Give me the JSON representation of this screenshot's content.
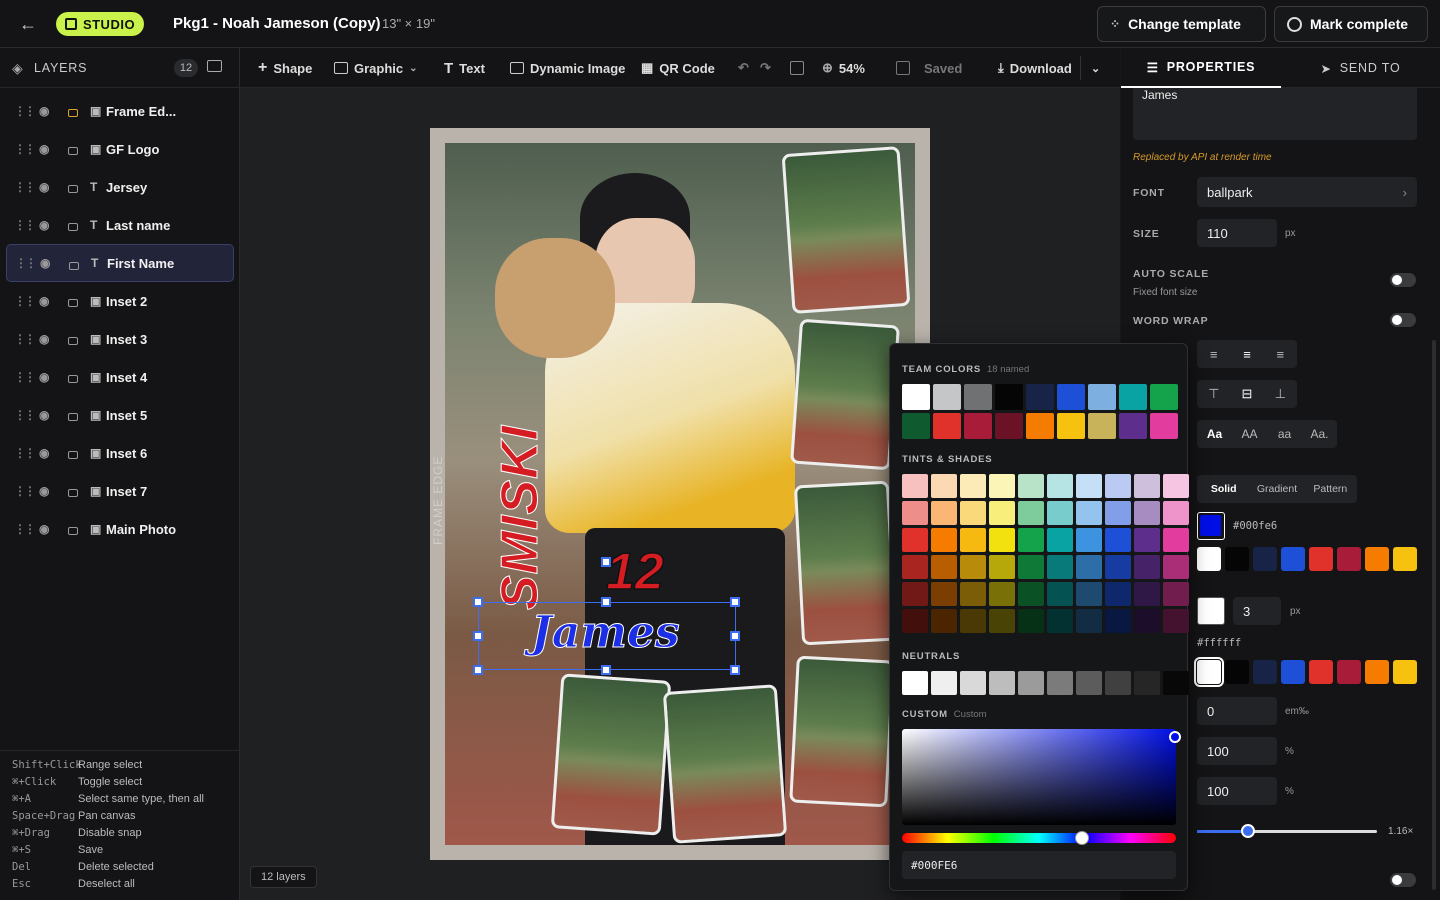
{
  "top": {
    "badge": "STUDIO",
    "title": "Pkg1 - Noah Jameson (Copy)",
    "size": "13\" × 19\"",
    "change_template": "Change template",
    "mark_complete": "Mark complete"
  },
  "sidebar": {
    "title": "LAYERS",
    "count": "12",
    "layers": [
      {
        "name": "Frame Ed...",
        "type": "img",
        "locked_accent": true
      },
      {
        "name": "GF Logo",
        "type": "img"
      },
      {
        "name": "Jersey",
        "type": "text"
      },
      {
        "name": "Last name",
        "type": "text"
      },
      {
        "name": "First Name",
        "type": "text",
        "selected": true
      },
      {
        "name": "Inset 2",
        "type": "img"
      },
      {
        "name": "Inset 3",
        "type": "img"
      },
      {
        "name": "Inset 4",
        "type": "img"
      },
      {
        "name": "Inset 5",
        "type": "img"
      },
      {
        "name": "Inset 6",
        "type": "img"
      },
      {
        "name": "Inset 7",
        "type": "img"
      },
      {
        "name": "Main Photo",
        "type": "img"
      }
    ],
    "shortcuts": [
      [
        "Shift+Click",
        "Range select"
      ],
      [
        "⌘+Click",
        "Toggle select"
      ],
      [
        "⌘+A",
        "Select same type, then all"
      ],
      [
        "Space+Drag",
        "Pan canvas"
      ],
      [
        "⌘+Drag",
        "Disable snap"
      ],
      [
        "⌘+S",
        "Save"
      ],
      [
        "Del",
        "Delete selected"
      ],
      [
        "Esc",
        "Deselect all"
      ]
    ]
  },
  "toolbar": {
    "shape": "Shape",
    "graphic": "Graphic",
    "text": "Text",
    "dynamic_image": "Dynamic Image",
    "qr_code": "QR Code",
    "zoom": "54%",
    "saved": "Saved",
    "download": "Download"
  },
  "canvas": {
    "layer_count": "12 layers",
    "frame_text": "FRAME EDGE",
    "last_name": "SMISKI",
    "jersey": "12",
    "first_name": "James"
  },
  "panel": {
    "tab_properties": "PROPERTIES",
    "tab_send": "SEND TO",
    "text_value": "James",
    "api_note": "Replaced by API at render time",
    "font_label": "FONT",
    "font_value": "ballpark",
    "size_label": "SIZE",
    "size_value": "110",
    "size_unit": "px",
    "auto_scale": "AUTO SCALE",
    "auto_scale_sub": "Fixed font size",
    "word_wrap": "WORD WRAP",
    "case_opts": [
      "Aa",
      "AA",
      "aa",
      "Aa."
    ],
    "fill_tabs": [
      "Solid",
      "Gradient",
      "Pattern"
    ],
    "fill_hex": "#000fe6",
    "stroke_width": "3",
    "stroke_unit": "px",
    "stroke_hex": "#ffffff",
    "tracking": "0",
    "tracking_unit": "em‰",
    "scale_x": "100",
    "scale_y": "100",
    "pct": "%",
    "scale_val": "1.16×",
    "fill_color": "#000fe6",
    "stroke_color": "#ffffff"
  },
  "picker": {
    "team_title": "TEAM COLORS",
    "team_sub": "18 named",
    "tints_title": "TINTS & SHADES",
    "neutrals_title": "NEUTRALS",
    "custom_title": "CUSTOM",
    "custom_sub": "Custom",
    "hex_value": "#000FE6",
    "team_colors": [
      "#ffffff",
      "#c4c6c8",
      "#6f7173",
      "#050505",
      "#172447",
      "#1d4fd7",
      "#7db0e0",
      "#0aa3a3",
      "#14a24a",
      "#0f5a2e",
      "#e0312b",
      "#a81c3a",
      "#6b1226",
      "#f57c00",
      "#f6c10f",
      "#c9b35a",
      "#5d2e8c",
      "#e13c9e"
    ],
    "neutrals": [
      "#ffffff",
      "#efefef",
      "#d9d9d9",
      "#bdbdbd",
      "#9b9b9b",
      "#7b7b7b",
      "#5c5c5c",
      "#404040",
      "#262626",
      "#080808"
    ],
    "hues": [
      "#e0312b",
      "#f57c00",
      "#f6b90f",
      "#f2e00f",
      "#14a24a",
      "#0aa3a3",
      "#3d93e0",
      "#1d4fd7",
      "#5d2e8c",
      "#e13c9e"
    ],
    "fill_swatches": [
      "#ffffff",
      "#050505",
      "#172447",
      "#1d4fd7",
      "#e0312b",
      "#a81c3a",
      "#f57c00",
      "#f6c10f"
    ]
  }
}
